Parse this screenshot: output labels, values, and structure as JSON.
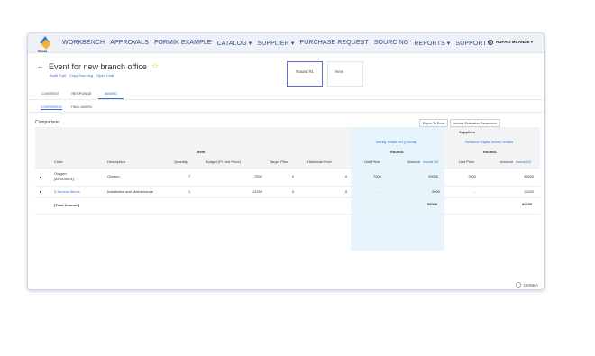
{
  "logo": {
    "text": "Omnea"
  },
  "nav": [
    "WORKBENCH",
    "APPROVALS",
    "FORMIK EXAMPLE",
    "CATALOG ▾",
    "SUPPLIER ▾",
    "PURCHASE REQUEST",
    "SOURCING",
    "REPORTS ▾",
    "SUPPORT ▾"
  ],
  "user": {
    "name": "RUPALI MCANDE ▾"
  },
  "header": {
    "title": "Event for new branch office",
    "audit": "Audit Trail",
    "copy": "Copy Sourcing",
    "chat": "Open Chat"
  },
  "rounds": {
    "round": "Round #1",
    "new": "New"
  },
  "tabs": [
    "CONTENT",
    "RESPONSE",
    "AWARD"
  ],
  "subtabs": [
    "COMPARISON",
    "FINAL AWARD"
  ],
  "comparison": {
    "label": "Comparison",
    "export": "Export To Excel",
    "include": "Include Evaluation Parameters"
  },
  "table": {
    "group_item": "Item",
    "group_suppliers": "Suppliers",
    "supplier1": "Infinity Retail Ltd (Croma)",
    "supplier2": "Reliance Digital World Limited",
    "round1": "Round1",
    "round2": "Round1",
    "headers": {
      "code": "Code",
      "description": "Description",
      "quantity": "Quantity",
      "budget": "Budget (Pr Unit Price)",
      "target": "Target Price",
      "historical": "Historical Price",
      "unit_price": "Unit Price",
      "amount": "Amount",
      "award_all": "Award All",
      "unit_price2": "Unit Price",
      "amount2": "Amount",
      "award_all2": "Award All"
    },
    "rows": [
      {
        "code": "Oxygen",
        "code2": "[ACD00001]",
        "description": "Oxygen",
        "quantity": "7",
        "budget": "7500",
        "target": "0",
        "historical": "0",
        "unit1": "7000",
        "amount1": "49000",
        "unit2": "7000",
        "amount2": "49000"
      },
      {
        "code": "3 Service Item/s",
        "code2": "",
        "description": "Installation and Maintenance",
        "quantity": "1",
        "budget": "12250",
        "target": "0",
        "historical": "0",
        "unit1": "-",
        "amount1": "9000",
        "unit2": "-",
        "amount2": "11200"
      }
    ],
    "total_label": "[Total Amount]",
    "total1": "58000",
    "total2": "60200"
  },
  "footer": {
    "brand": "OMNEA"
  },
  "colors": {
    "accent": "#3a6fd8",
    "highlight": "#e7f4fb",
    "star": "#f0b400"
  }
}
